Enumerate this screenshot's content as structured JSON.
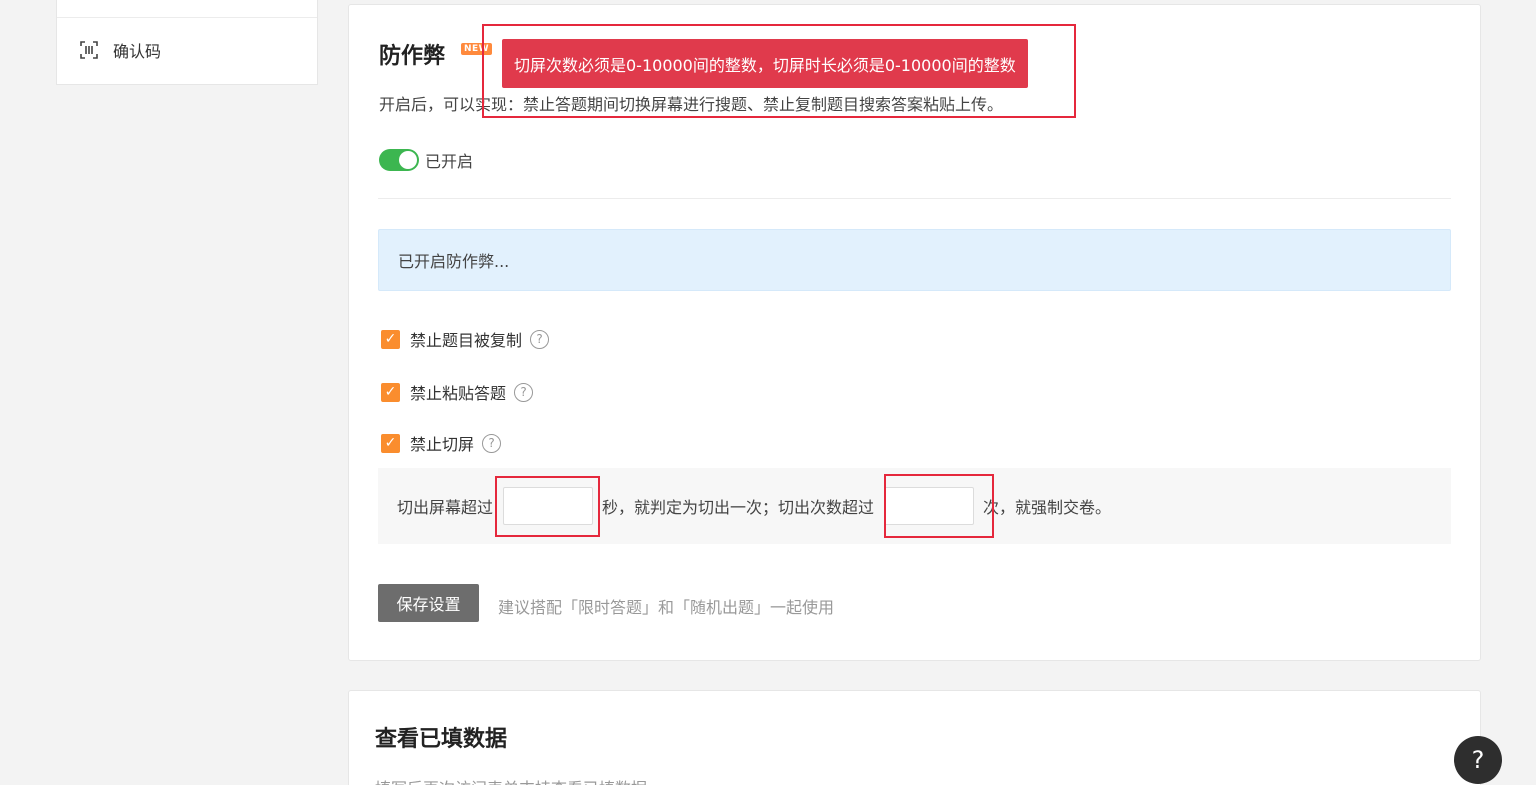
{
  "sidebar": {
    "items": [
      {
        "label": "确认码",
        "icon": "scan-icon"
      }
    ]
  },
  "anticheat": {
    "title": "防作弊",
    "badge": "NEW",
    "description": "开启后，可以实现：禁止答题期间切换屏幕进行搜题、禁止复制题目搜索答案粘贴上传。",
    "switch_label": "已开启",
    "switch_on": true,
    "info_text": "已开启防作弊...",
    "options": [
      {
        "label": "禁止题目被复制",
        "checked": true
      },
      {
        "label": "禁止粘贴答题",
        "checked": true
      },
      {
        "label": "禁止切屏",
        "checked": true
      }
    ],
    "switch_rule": {
      "prefix": "切出屏幕超过",
      "seconds_value": "",
      "middle": "秒，就判定为切出一次；切出次数超过",
      "count_value": "",
      "suffix": "次，就强制交卷。"
    },
    "save_label": "保存设置",
    "save_hint": "建议搭配「限时答题」和「随机出题」一起使用"
  },
  "data_section": {
    "title": "查看已填数据",
    "subtitle": "填写后再次访问表单支持查看已填数据"
  },
  "toast": {
    "message": "切屏次数必须是0-10000间的整数，切屏时长必须是0-10000间的整数"
  },
  "float_help": {
    "icon": "question-icon",
    "glyph": "?"
  },
  "colors": {
    "accent_orange": "#fa8d2e",
    "switch_green": "#3cb650",
    "error_red": "#e03a4c"
  }
}
